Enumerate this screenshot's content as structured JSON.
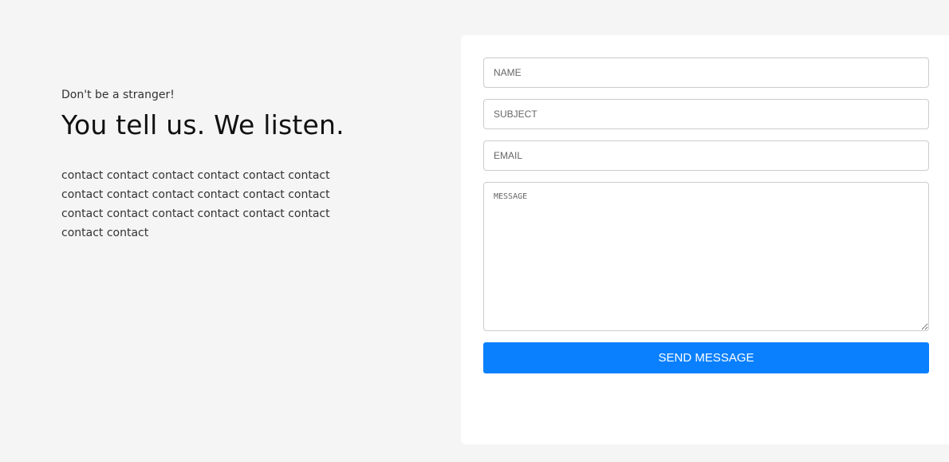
{
  "intro": {
    "kicker": "Don't be a stranger!",
    "headline": "You tell us. We listen.",
    "body": "contact contact contact contact contact contact contact contact contact contact contact contact contact contact contact contact contact contact contact contact"
  },
  "form": {
    "name_placeholder": "NAME",
    "subject_placeholder": "SUBJECT",
    "email_placeholder": "EMAIL",
    "message_placeholder": "MESSAGE",
    "submit_label": "SEND MESSAGE"
  },
  "colors": {
    "page_background": "#f5f5f5",
    "card_background": "#ffffff",
    "accent": "#0a80ff"
  }
}
